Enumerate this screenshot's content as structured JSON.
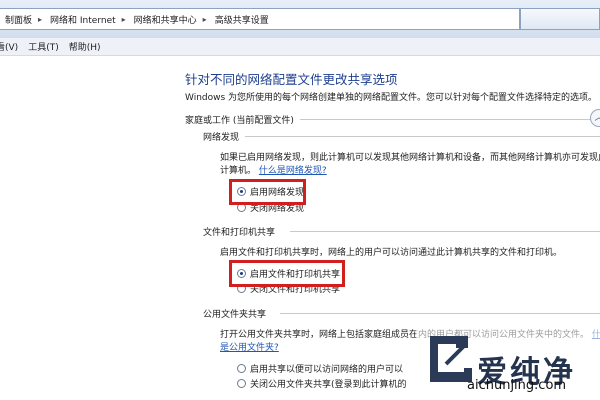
{
  "breadcrumb": [
    "制面板",
    "网络和 Internet",
    "网络和共享中心",
    "高级共享设置"
  ],
  "menu": [
    "看(V)",
    "工具(T)",
    "帮助(H)"
  ],
  "page": {
    "heading": "针对不同的网络配置文件更改共享选项",
    "intro": "Windows 为您所使用的每个网络创建单独的网络配置文件。您可以针对每个配置文件选择特定的选项。",
    "profile_label": "家庭或工作 (当前配置文件)"
  },
  "discovery": {
    "title": "网络发现",
    "desc_line1": "如果已启用网络发现，则此计算机可以发现其他网络计算机和设备，而其他网络计算机亦可发现此",
    "desc_line2": "计算机。",
    "link": "什么是网络发现?",
    "option_on": "启用网络发现",
    "option_off": "关闭网络发现",
    "selected": "on"
  },
  "printer_sharing": {
    "title": "文件和打印机共享",
    "desc": "启用文件和打印机共享时，网络上的用户可以访问通过此计算机共享的文件和打印机。",
    "option_on": "启用文件和打印机共享",
    "option_off": "关闭文件和打印机共享",
    "selected": "on"
  },
  "public_folder": {
    "title": "公用文件夹共享",
    "desc_line1": "打开公用文件夹共享时，网络上包括家庭组成员在内的用户都可以访问公用文件夹中的文件。",
    "desc_tail": "什么",
    "link": "是公用文件夹?",
    "option_on": "启用共享以便可以访问网络的用户可以",
    "option_off": "关闭公用文件夹共享(登录到此计算机的"
  },
  "watermark": {
    "brand": "爱纯净",
    "url": "aichunjing.com"
  },
  "colors": {
    "highlight": "#d11f1f",
    "heading": "#1e3f8f",
    "link": "#1f57b5"
  }
}
